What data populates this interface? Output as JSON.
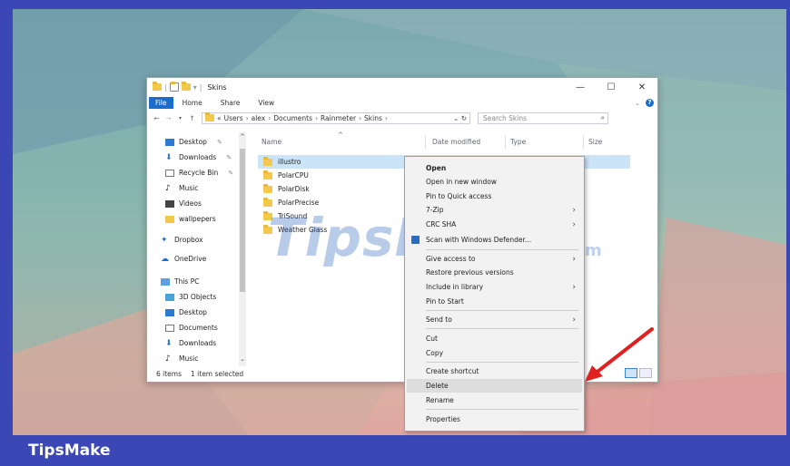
{
  "brand": "TipsMake",
  "watermark": {
    "text": "TipsMake",
    "suffix": ".com"
  },
  "window": {
    "title": "Skins",
    "controls": {
      "minimize": "—",
      "maximize": "☐",
      "close": "✕"
    }
  },
  "ribbon": {
    "tabs": [
      "File",
      "Home",
      "Share",
      "View"
    ]
  },
  "address": {
    "prefix": "«",
    "crumbs": [
      "Users",
      "alex",
      "Documents",
      "Rainmeter",
      "Skins"
    ],
    "separator": "›",
    "search_placeholder": "Search Skins"
  },
  "nav_pane": {
    "items": [
      {
        "label": "Desktop",
        "icon": "desktop-icon",
        "pinned": true
      },
      {
        "label": "Downloads",
        "icon": "download-icon",
        "pinned": true
      },
      {
        "label": "Recycle Bin",
        "icon": "recycle-bin-icon",
        "pinned": true
      },
      {
        "label": "Music",
        "icon": "music-icon",
        "pinned": false
      },
      {
        "label": "Videos",
        "icon": "video-icon",
        "pinned": false
      },
      {
        "label": "wallpepers",
        "icon": "folder-icon",
        "pinned": false
      },
      {
        "label": "Dropbox",
        "icon": "dropbox-icon",
        "pinned": false
      },
      {
        "label": "OneDrive",
        "icon": "onedrive-icon",
        "pinned": false
      },
      {
        "label": "This PC",
        "icon": "pc-icon",
        "pinned": false
      },
      {
        "label": "3D Objects",
        "icon": "3d-objects-icon",
        "pinned": false
      },
      {
        "label": "Desktop",
        "icon": "desktop-icon",
        "pinned": false
      },
      {
        "label": "Documents",
        "icon": "documents-icon",
        "pinned": false
      },
      {
        "label": "Downloads",
        "icon": "download-icon",
        "pinned": false
      },
      {
        "label": "Music",
        "icon": "music-icon",
        "pinned": false
      }
    ]
  },
  "columns": {
    "name": "Name",
    "date": "Date modified",
    "type": "Type",
    "size": "Size"
  },
  "files": [
    {
      "name": "illustro",
      "selected": true
    },
    {
      "name": "PolarCPU",
      "selected": false
    },
    {
      "name": "PolarDisk",
      "selected": false
    },
    {
      "name": "PolarPrecise",
      "selected": false
    },
    {
      "name": "TriSound",
      "selected": false
    },
    {
      "name": "Weather Glass",
      "selected": false
    }
  ],
  "status": {
    "items": "6 items",
    "selected": "1 item selected"
  },
  "context_menu": {
    "items": [
      {
        "label": "Open",
        "bold": true
      },
      {
        "label": "Open in new window"
      },
      {
        "label": "Pin to Quick access"
      },
      {
        "label": "7-Zip",
        "submenu": true
      },
      {
        "label": "CRC SHA",
        "submenu": true
      },
      {
        "label": "Scan with Windows Defender...",
        "icon": "windows-defender-icon"
      },
      {
        "label": "Give access to",
        "submenu": true
      },
      {
        "label": "Restore previous versions"
      },
      {
        "label": "Include in library",
        "submenu": true
      },
      {
        "label": "Pin to Start"
      },
      {
        "label": "Send to",
        "submenu": true
      },
      {
        "label": "Cut"
      },
      {
        "label": "Copy"
      },
      {
        "label": "Create shortcut"
      },
      {
        "label": "Delete",
        "highlighted": true
      },
      {
        "label": "Rename"
      },
      {
        "label": "Properties"
      }
    ]
  },
  "colors": {
    "accent": "#1a6dc9",
    "selection": "#cce4f7",
    "brand_bar": "#3a47b4",
    "arrow": "#e02020"
  }
}
